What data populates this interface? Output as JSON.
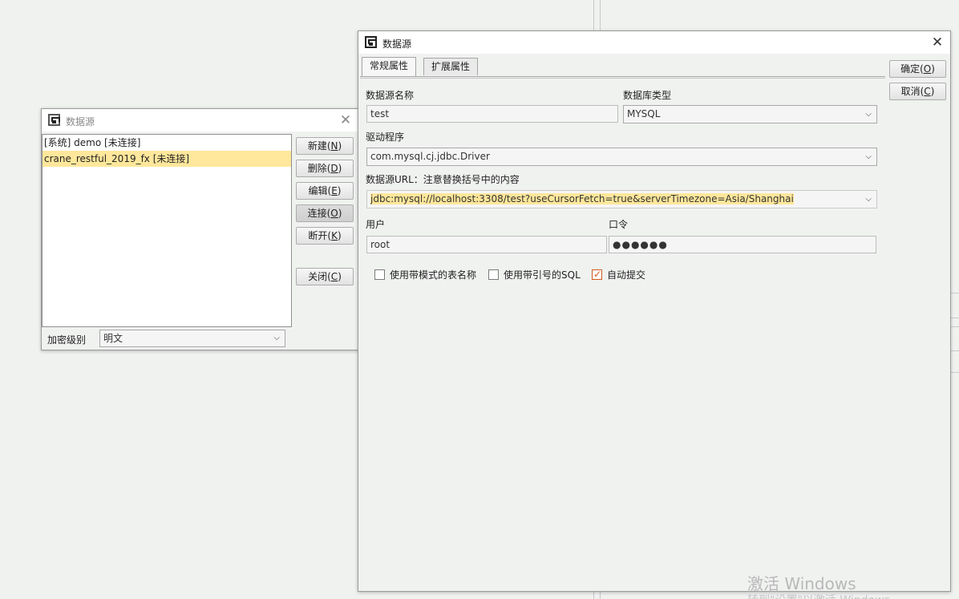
{
  "small_window": {
    "title": "数据源",
    "close": "✕",
    "list": [
      {
        "label": "[系统] demo [未连接]",
        "selected": false
      },
      {
        "label": "crane_restful_2019_fx [未连接]",
        "selected": true
      }
    ],
    "buttons": {
      "new": {
        "label": "新建(",
        "key": "N",
        "end": ")"
      },
      "delete": {
        "label": "删除(",
        "key": "D",
        "end": ")"
      },
      "edit": {
        "label": "编辑(",
        "key": "E",
        "end": ")"
      },
      "connect": {
        "label": "连接(",
        "key": "O",
        "end": ")"
      },
      "disconnect": {
        "label": "断开(",
        "key": "K",
        "end": ")"
      },
      "close": {
        "label": "关闭(",
        "key": "C",
        "end": ")"
      }
    },
    "encryption_label": "加密级别",
    "encryption_value": "明文"
  },
  "main_window": {
    "title": "数据源",
    "close": "✕",
    "tabs": [
      "常规属性",
      "扩展属性"
    ],
    "ok": {
      "label": "确定(",
      "key": "O",
      "end": ")"
    },
    "cancel": {
      "label": "取消(",
      "key": "C",
      "end": ")"
    },
    "name_label": "数据源名称",
    "name_value": "test",
    "dbtype_label": "数据库类型",
    "dbtype_value": "MYSQL",
    "driver_label": "驱动程序",
    "driver_value": "com.mysql.cj.jdbc.Driver",
    "url_label": "数据源URL：注意替换括号中的内容",
    "url_value": "jdbc:mysql://localhost:3308/test?useCursorFetch=true&serverTimezone=Asia/Shanghai",
    "user_label": "用户",
    "user_value": "root",
    "password_label": "口令",
    "password_value": "●●●●●●",
    "checkboxes": [
      {
        "label": "使用带模式的表名称",
        "checked": false
      },
      {
        "label": "使用带引号的SQL",
        "checked": false
      },
      {
        "label": "自动提交",
        "checked": true
      }
    ]
  },
  "watermark": {
    "line1": "激活 Windows",
    "line2": "转到\"设置\"以激活 Windows。"
  },
  "icons": {
    "dropdown": "chevron-down-icon",
    "close": "close-icon",
    "app": "app-icon"
  }
}
